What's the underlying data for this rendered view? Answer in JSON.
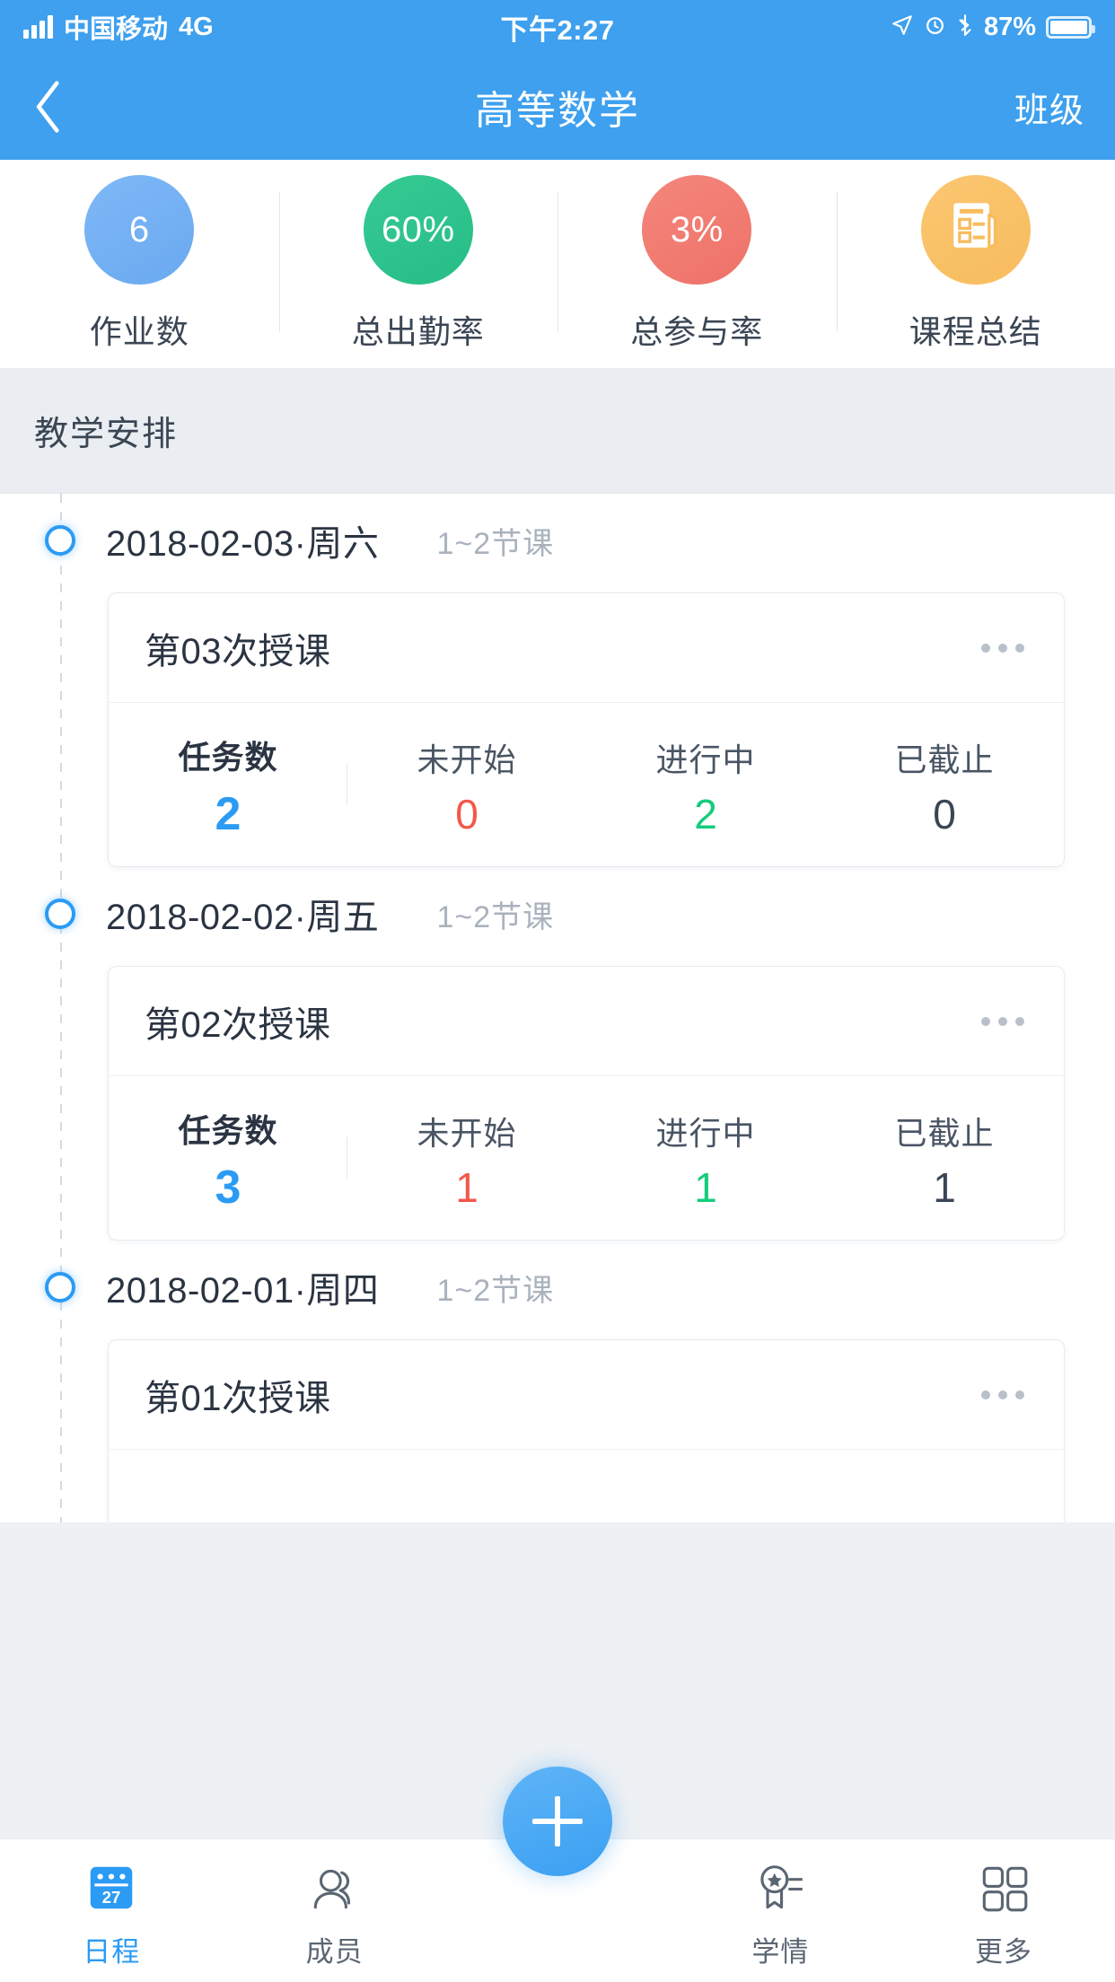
{
  "status_bar": {
    "carrier": "中国移动",
    "network": "4G",
    "time": "下午2:27",
    "battery_percent": "87%",
    "icons": [
      "signal-icon",
      "location-arrow-icon",
      "alarm-clock-icon",
      "bluetooth-icon",
      "battery-icon"
    ]
  },
  "nav": {
    "back_icon": "chevron-left-icon",
    "title": "高等数学",
    "right_action": "班级"
  },
  "stats": [
    {
      "value": "6",
      "label": "作业数",
      "color": "#6aa9f0",
      "icon": null
    },
    {
      "value": "60%",
      "label": "总出勤率",
      "color": "#27bd87",
      "icon": null
    },
    {
      "value": "3%",
      "label": "总参与率",
      "color": "#ee7268",
      "icon": null
    },
    {
      "value": "",
      "label": "课程总结",
      "color": "#f7bc5d",
      "icon": "document-list-icon"
    }
  ],
  "section": {
    "title": "教学安排"
  },
  "timeline": [
    {
      "date": "2018-02-03·周六",
      "period": "1~2节课",
      "card": {
        "title": "第03次授课",
        "menu_icon": "more-horizontal-icon",
        "stats": [
          {
            "label": "任务数",
            "value": "2",
            "tone": "blue"
          },
          {
            "label": "未开始",
            "value": "0",
            "tone": "red"
          },
          {
            "label": "进行中",
            "value": "2",
            "tone": "green"
          },
          {
            "label": "已截止",
            "value": "0",
            "tone": "dark"
          }
        ]
      }
    },
    {
      "date": "2018-02-02·周五",
      "period": "1~2节课",
      "card": {
        "title": "第02次授课",
        "menu_icon": "more-horizontal-icon",
        "stats": [
          {
            "label": "任务数",
            "value": "3",
            "tone": "blue"
          },
          {
            "label": "未开始",
            "value": "1",
            "tone": "red"
          },
          {
            "label": "进行中",
            "value": "1",
            "tone": "green"
          },
          {
            "label": "已截止",
            "value": "1",
            "tone": "dark"
          }
        ]
      }
    },
    {
      "date": "2018-02-01·周四",
      "period": "1~2节课",
      "card": {
        "title": "第01次授课",
        "menu_icon": "more-horizontal-icon",
        "stats": []
      }
    }
  ],
  "fab": {
    "icon": "plus-icon"
  },
  "tabbar": {
    "items": [
      {
        "label": "日程",
        "icon": "calendar-27-icon",
        "active": true
      },
      {
        "label": "成员",
        "icon": "people-icon",
        "active": false
      },
      {
        "label": "学情",
        "icon": "ribbon-star-icon",
        "active": false
      },
      {
        "label": "更多",
        "icon": "grid-icon",
        "active": false
      }
    ]
  },
  "colors": {
    "brand_blue": "#3EA0EE",
    "accent_blue": "#2b9bf4",
    "green": "#14cc7c",
    "red": "#f2584a",
    "yellow": "#f7bc5d",
    "page_bg": "#eaeef2"
  }
}
